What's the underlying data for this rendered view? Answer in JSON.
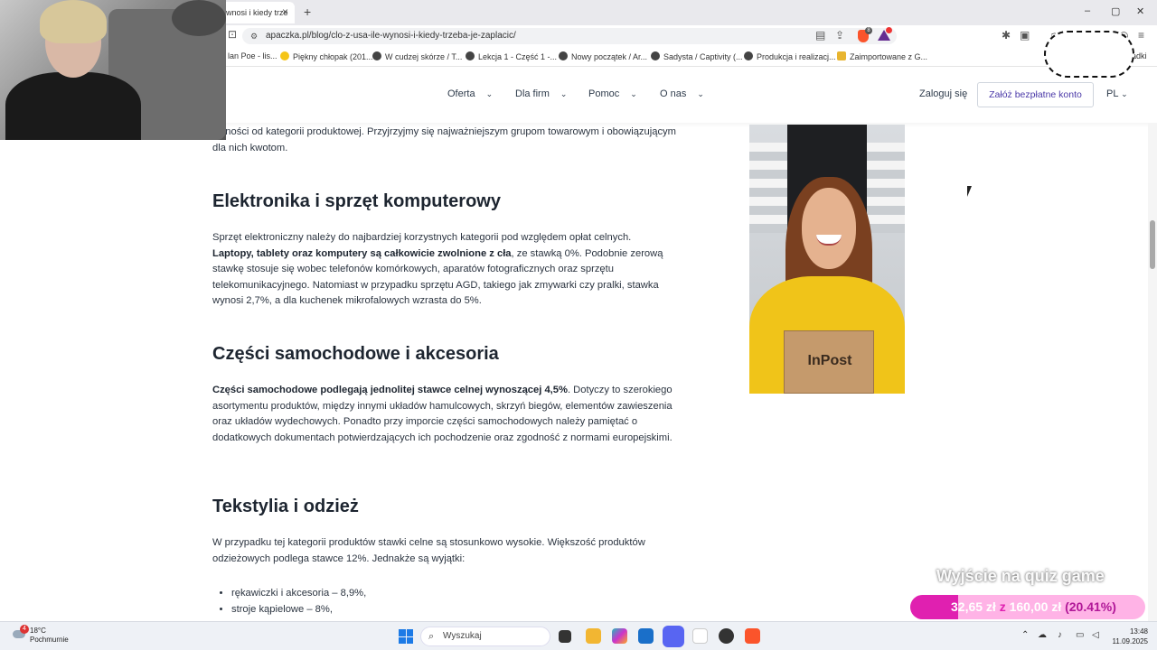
{
  "browser": {
    "tab_title": "wnosi i kiedy trze",
    "tab_close": "×",
    "new_tab": "+",
    "url": "apaczka.pl/blog/clo-z-usa-ile-wynosi-i-kiedy-trzeba-je-zaplacic/",
    "window_controls": [
      "–",
      "▢",
      "✕"
    ],
    "bookmarks": [
      {
        "label": "lan Poe - lis...",
        "icon": "page"
      },
      {
        "label": "Piękny chłopak (201...",
        "icon": "smiley"
      },
      {
        "label": "W cudzej skórze / T...",
        "icon": "page"
      },
      {
        "label": "Lekcja 1 - Część 1 -...",
        "icon": "page"
      },
      {
        "label": "Nowy początek / Ar...",
        "icon": "page"
      },
      {
        "label": "Sadysta / Captivity (...",
        "icon": "page"
      },
      {
        "label": "Produkcja i realizacj...",
        "icon": "page"
      },
      {
        "label": "Zaimportowane z G...",
        "icon": "folder"
      },
      {
        "label": "adki",
        "icon": "folder"
      }
    ],
    "brave_badge": "8"
  },
  "site": {
    "nav": [
      "Oferta",
      "Dla firm",
      "Pomoc",
      "O nas"
    ],
    "login": "Zaloguj się",
    "cta": "Załóż bezpłatne konto",
    "lang": "PL"
  },
  "article": {
    "intro": "leżności od kategorii produktowej. Przyjrzyjmy się najważniejszym grupom towarowym i obowiązującym dla nich kwotom.",
    "h_electronics": "Elektronika i sprzęt komputerowy",
    "p_electronics_1": "Sprzęt elektroniczny należy do najbardziej korzystnych kategorii pod względem opłat celnych.",
    "p_electronics_bold": "Laptopy, tablety oraz komputery są całkowicie zwolnione z cła",
    "p_electronics_2": ", ze stawką 0%. Podobnie zerową stawkę stosuje się wobec telefonów komórkowych, aparatów fotograficznych oraz sprzętu telekomunikacyjnego. Natomiast w przypadku sprzętu AGD, takiego jak zmywarki czy pralki, stawka wynosi 2,7%, a dla kuchenek mikrofalowych wzrasta do 5%.",
    "h_auto": "Części samochodowe i akcesoria",
    "p_auto_bold": "Części samochodowe podlegają jednolitej stawce celnej wynoszącej 4,5%",
    "p_auto": ". Dotyczy to szerokiego asortymentu produktów, między innymi układów hamulcowych, skrzyń biegów, elementów zawieszenia oraz układów wydechowych. Ponadto przy imporcie części samochodowych należy pamiętać o dodatkowych dokumentach potwierdzających ich pochodzenie oraz zgodność z normami europejskimi.",
    "h_textile": "Tekstylia i odzież",
    "p_textile": "W przypadku tej kategorii produktów stawki celne są stosunkowo wysokie. Większość produktów odzieżowych podlega stawce 12%. Jednakże są wyjątki:",
    "list": [
      "rękawiczki i akcesoria – 8,9%,",
      "stroje kąpielowe – 8%,"
    ]
  },
  "promo_image": {
    "box_text": "InPost"
  },
  "quiz": {
    "title": "Wyjście na quiz game",
    "current": "32,65 zł",
    "sep": "z",
    "goal": "160,00 zł",
    "percent_text": "(20.41%)",
    "progress": 0.2041
  },
  "taskbar": {
    "weather_temp": "18°C",
    "weather_desc": "Pochmurnie",
    "weather_badge": "4",
    "search_placeholder": "Wyszukaj",
    "time": "13:48",
    "date": "11.09.2025"
  },
  "colors": {
    "accent": "#4b39a8",
    "quiz_fill": "#e020b0",
    "quiz_bg": "#ffb3e6"
  }
}
